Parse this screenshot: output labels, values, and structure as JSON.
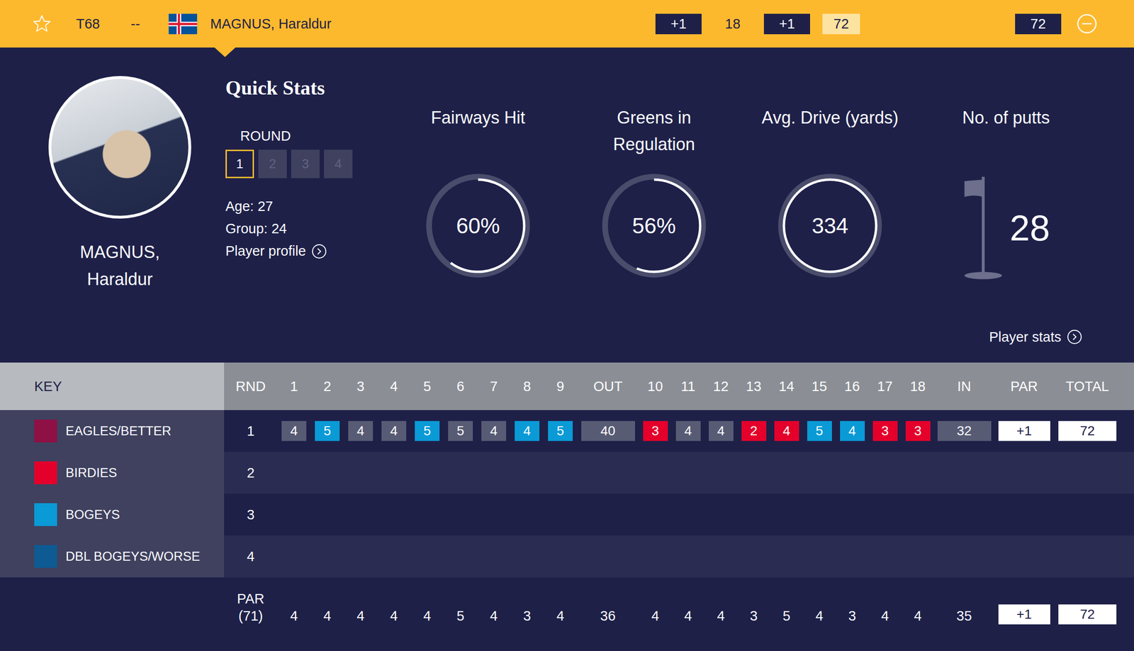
{
  "header": {
    "favorite": false,
    "position": "T68",
    "movement": "--",
    "name": "MAGNUS, Haraldur",
    "today": "+1",
    "thru": "18",
    "to_par": "+1",
    "round_score": "72",
    "total": "72"
  },
  "profile": {
    "name_line1": "MAGNUS,",
    "name_line2": "Haraldur",
    "age": "Age: 27",
    "group": "Group: 24",
    "profile_link": "Player profile"
  },
  "quick_stats": {
    "title": "Quick Stats",
    "round_label": "ROUND",
    "rounds": [
      {
        "label": "1",
        "selected": true
      },
      {
        "label": "2",
        "selected": false
      },
      {
        "label": "3",
        "selected": false
      },
      {
        "label": "4",
        "selected": false
      }
    ]
  },
  "stats": [
    {
      "label": "Fairways Hit",
      "value": "60%",
      "level": 0.6,
      "kind": "ring"
    },
    {
      "label": "Greens in Regulation",
      "value": "56%",
      "level": 0.56,
      "kind": "ring"
    },
    {
      "label": "Avg. Drive (yards)",
      "value": "334",
      "level": 1,
      "kind": "ring"
    },
    {
      "label": "No. of putts",
      "value": "28",
      "level": 0,
      "kind": "flag"
    }
  ],
  "stats_link": "Player stats",
  "key": {
    "title": "KEY",
    "items": [
      {
        "label": "EAGLES/BETTER",
        "result": "eagle",
        "color": "#8e1045"
      },
      {
        "label": "BIRDIES",
        "result": "birdie",
        "color": "#e4002b"
      },
      {
        "label": "BOGEYS",
        "result": "bogey",
        "color": "#0a9ad6"
      },
      {
        "label": "DBL BOGEYS/WORSE",
        "result": "double",
        "color": "#0e5a92"
      }
    ]
  },
  "scorecard": {
    "columns": [
      "RND",
      "1",
      "2",
      "3",
      "4",
      "5",
      "6",
      "7",
      "8",
      "9",
      "OUT",
      "10",
      "11",
      "12",
      "13",
      "14",
      "15",
      "16",
      "17",
      "18",
      "IN",
      "PAR",
      "TOTAL"
    ],
    "rows": [
      {
        "round": "1",
        "holes": [
          {
            "score": "4",
            "result": "par"
          },
          {
            "score": "5",
            "result": "bogey"
          },
          {
            "score": "4",
            "result": "par"
          },
          {
            "score": "4",
            "result": "par"
          },
          {
            "score": "5",
            "result": "bogey"
          },
          {
            "score": "5",
            "result": "par"
          },
          {
            "score": "4",
            "result": "par"
          },
          {
            "score": "4",
            "result": "bogey"
          },
          {
            "score": "5",
            "result": "bogey"
          },
          {
            "score": "3",
            "result": "birdie"
          },
          {
            "score": "4",
            "result": "par"
          },
          {
            "score": "4",
            "result": "par"
          },
          {
            "score": "2",
            "result": "birdie"
          },
          {
            "score": "4",
            "result": "birdie"
          },
          {
            "score": "5",
            "result": "bogey"
          },
          {
            "score": "4",
            "result": "bogey"
          },
          {
            "score": "3",
            "result": "birdie"
          },
          {
            "score": "3",
            "result": "birdie"
          }
        ],
        "out": "40",
        "in": "32",
        "par": "+1",
        "total": "72"
      },
      {
        "round": "2",
        "holes": [],
        "out": "",
        "in": "",
        "par": "",
        "total": ""
      },
      {
        "round": "3",
        "holes": [],
        "out": "",
        "in": "",
        "par": "",
        "total": ""
      },
      {
        "round": "4",
        "holes": [],
        "out": "",
        "in": "",
        "par": "",
        "total": ""
      }
    ],
    "par_row": {
      "label": "PAR",
      "total_par": "(71)",
      "holes": [
        "4",
        "4",
        "4",
        "4",
        "4",
        "5",
        "4",
        "3",
        "4",
        "4",
        "4",
        "4",
        "3",
        "5",
        "4",
        "3",
        "4",
        "4"
      ],
      "out": "36",
      "in": "35",
      "par": "+1",
      "total": "72"
    }
  }
}
